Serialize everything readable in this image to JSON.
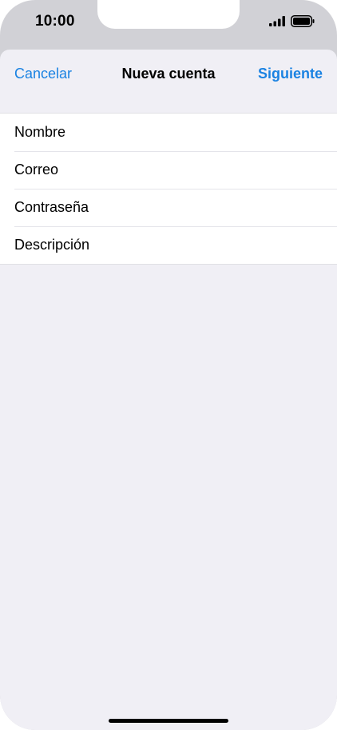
{
  "status_bar": {
    "time": "10:00",
    "icons": [
      "cellular-signal-icon",
      "battery-icon"
    ]
  },
  "nav": {
    "cancel_label": "Cancelar",
    "title": "Nueva cuenta",
    "next_label": "Siguiente"
  },
  "form": {
    "fields": [
      {
        "placeholder": "Nombre",
        "value": ""
      },
      {
        "placeholder": "Correo",
        "value": ""
      },
      {
        "placeholder": "Contraseña",
        "value": ""
      },
      {
        "placeholder": "Descripción",
        "value": ""
      }
    ]
  },
  "colors": {
    "accent": "#1a82e2",
    "sheet_background": "#f0eff5",
    "behind_sheet": "#d1d1d6"
  }
}
